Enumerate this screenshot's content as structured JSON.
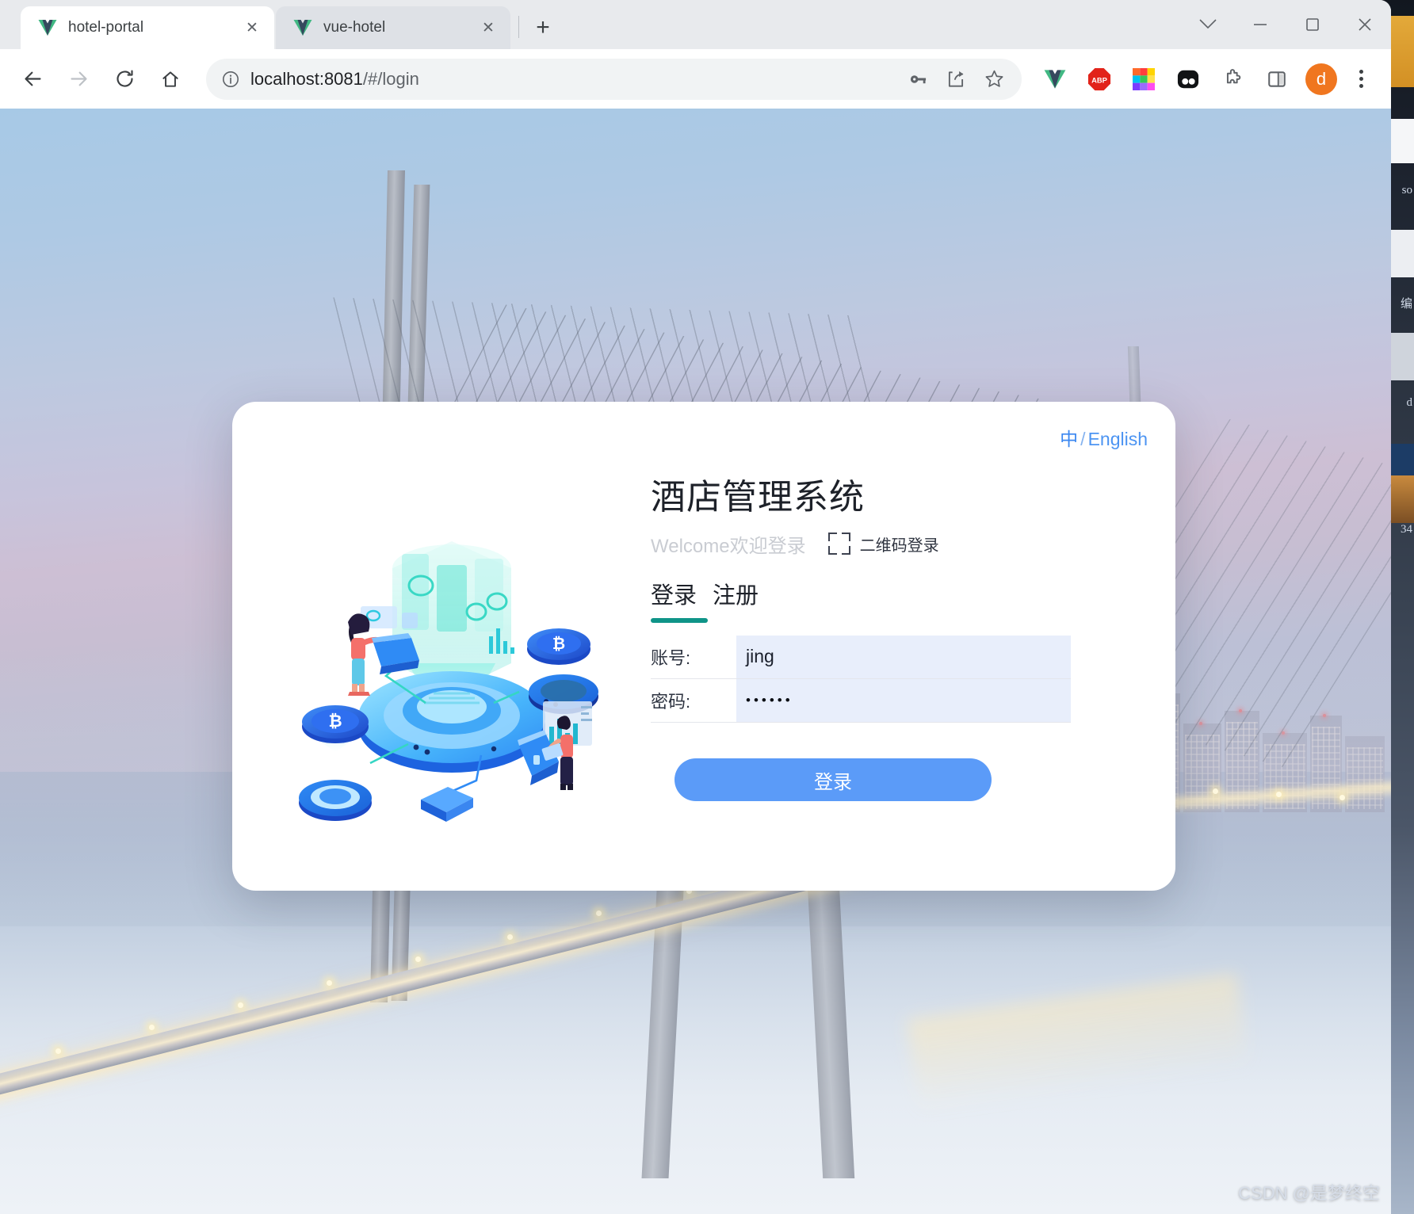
{
  "window": {
    "controls": [
      {
        "name": "tab-search-chevron",
        "glyph": "⌄"
      },
      {
        "name": "minimize",
        "glyph": "—"
      },
      {
        "name": "maximize",
        "glyph": "□"
      },
      {
        "name": "close",
        "glyph": "✕"
      }
    ]
  },
  "tabs": [
    {
      "title": "hotel-portal",
      "favicon": "vue-logo-icon",
      "active": true,
      "close": "✕"
    },
    {
      "title": "vue-hotel",
      "favicon": "vue-logo-icon",
      "active": false,
      "close": "✕"
    }
  ],
  "new_tab_label": "+",
  "toolbar": {
    "back": "←",
    "forward": "→",
    "reload": "↻",
    "home": "⌂",
    "url_host": "localhost:8081",
    "url_path": "/#/login",
    "url_full": "localhost:8081/#/login",
    "site_info_icon": "info-circle-icon",
    "password_icon": "key-icon",
    "share_icon": "share-icon",
    "bookmark_icon": "star-icon",
    "extensions": [
      {
        "name": "vue-devtools-extension-icon",
        "label": "V"
      },
      {
        "name": "adblock-plus-extension-icon",
        "label": "ABP"
      },
      {
        "name": "color-grid-extension-icon",
        "label": ""
      },
      {
        "name": "pocket-extension-icon",
        "label": ""
      },
      {
        "name": "puzzle-extensions-icon",
        "label": ""
      },
      {
        "name": "side-panel-icon",
        "label": ""
      }
    ],
    "avatar_letter": "d",
    "menu_icon": "three-dots-vertical-icon"
  },
  "login": {
    "lang": {
      "cn": "中",
      "sep": "/",
      "en": "English"
    },
    "title": "酒店管理系统",
    "welcome": "Welcome欢迎登录",
    "qr_label": "二维码登录",
    "qr_icon": "qr-scan-frame-icon",
    "tabs": [
      {
        "label": "登录",
        "active": true
      },
      {
        "label": "注册",
        "active": false
      }
    ],
    "fields": [
      {
        "label": "账号:",
        "value": "jing",
        "type": "text",
        "placeholder": ""
      },
      {
        "label": "密码:",
        "value": "••••••",
        "type": "password",
        "placeholder": ""
      }
    ],
    "submit_label": "登录",
    "illustration": "isometric-blockchain-illustration",
    "accent_color": "#5b9bf8",
    "tab_underline_color": "#0f9488",
    "input_fill_color": "#e8eefb",
    "link_color": "#4c94f2"
  },
  "page_background": {
    "description": "cable-stayed-bridge-at-dusk-photo",
    "sky_color": "#b7c6dd",
    "river_color": "#c7d3e2",
    "light_trail_color": "#f4ead0"
  },
  "watermark": "CSDN @是梦终空",
  "desktop_slivers": [
    "so",
    "编",
    "d",
    "34"
  ]
}
